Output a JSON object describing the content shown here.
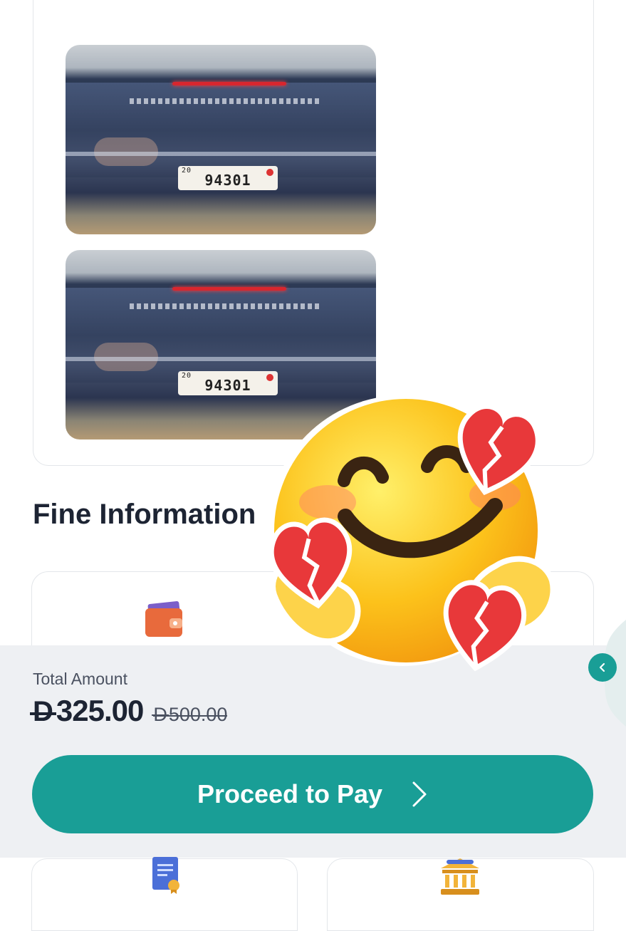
{
  "photos": [
    {
      "plate_code": "20",
      "plate_number": "94301"
    },
    {
      "plate_code": "20",
      "plate_number": "94301"
    }
  ],
  "fine_section": {
    "title": "Fine Information"
  },
  "icons": {
    "wallet": "wallet-icon",
    "certificate": "certificate-icon",
    "bank": "bank-icon",
    "sticker": "smiling-face-with-hearts-sticker"
  },
  "payment": {
    "total_label": "Total Amount",
    "currency_symbol": "D",
    "amount": "325.00",
    "old_amount": "500.00",
    "proceed_label": "Proceed to Pay"
  },
  "colors": {
    "accent": "#199e96",
    "panel_bg": "#eef0f3",
    "text_primary": "#1d2433"
  }
}
